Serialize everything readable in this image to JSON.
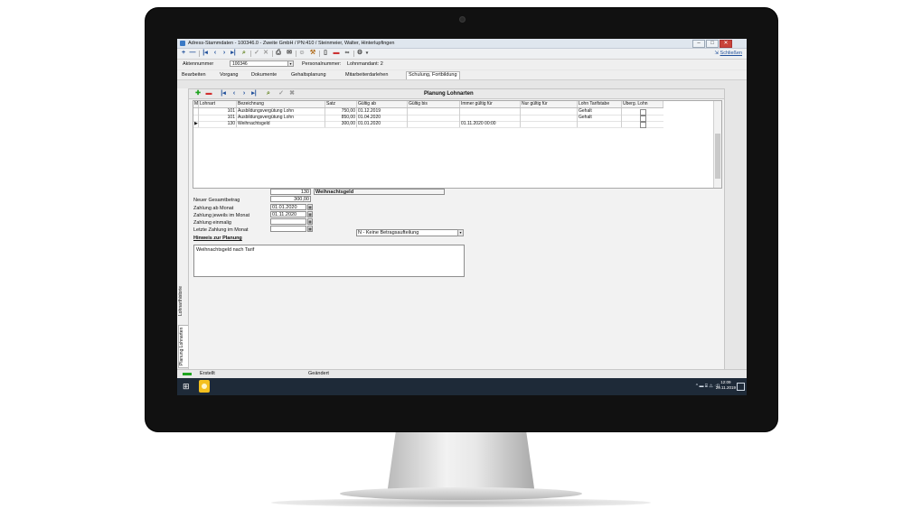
{
  "window": {
    "title": "Adress-Stammdaten - 100346.0 - Zweite GmbH / PN:410 / Steinmeier, Walter, Hinterlupfingen"
  },
  "toolbar": {
    "close_label": "Schließen"
  },
  "header_fields": {
    "aktennummer_label": "Aktennummer",
    "aktennummer_value": "100346",
    "personalnummer_label": "Personalnummer:",
    "lohnmandant_label": "Lohnmandant: 2"
  },
  "menu_tabs": [
    "Bearbeiten",
    "Vorgang",
    "Dokumente",
    "Gehaltsplanung",
    "Mitarbeiterdarlehen",
    "Schulung, Fortbildung"
  ],
  "side_tabs": [
    "Lohnarthistorie",
    "Planung Lohnarten"
  ],
  "panel": {
    "title": "Planung Lohnarten"
  },
  "grid": {
    "columns": [
      "M",
      "Lohnart",
      "Bezeichnung",
      "Satz",
      "Gültig ab",
      "Gültig bis",
      "Immer gültig für",
      "Nur gültig für",
      "Lohn Tarifstabe",
      "Überg. Lohn"
    ],
    "rows": [
      {
        "marker": "",
        "lohnart": "101",
        "bezeichnung": "Ausbildungsvergütung Lohn",
        "satz": "750,00",
        "gueltig_ab": "01.12.2019",
        "gueltig_bis": "",
        "immer": "",
        "nur": "",
        "tarif": "Gehalt"
      },
      {
        "marker": "",
        "lohnart": "101",
        "bezeichnung": "Ausbildungsvergütung Lohn",
        "satz": "850,00",
        "gueltig_ab": "01.04.2020",
        "gueltig_bis": "",
        "immer": "",
        "nur": "",
        "tarif": "Gehalt"
      },
      {
        "marker": "▶",
        "lohnart": "130",
        "bezeichnung": "Weihnachtsgeld",
        "satz": "300,00",
        "gueltig_ab": "01.01.2020",
        "gueltig_bis": "",
        "immer": "01.11.2020 00:00",
        "nur": "",
        "tarif": ""
      }
    ]
  },
  "detail": {
    "lohnart_nr": "130",
    "lohnart_name": "Weihnachtsgeld",
    "neuer_gesamtbetrag_label": "Neuer Gesamtbetrag",
    "neuer_gesamtbetrag_value": "300,00",
    "zahlung_ab_label": "Zahlung ab Monat",
    "zahlung_ab_value": "01.01.2020",
    "zahlung_jeweils_label": "Zahlung jeweils im Monat",
    "zahlung_jeweils_value": "01.11.2020",
    "zahlung_einmalig_label": "Zahlung einmalig",
    "letzte_zahlung_label": "Letzte Zahlung im Monat",
    "aufteilung_value": "N - Keine Betragsaufteilung",
    "hinweis_label": "Hinweis zur Planung",
    "hinweis_text": "Weihnachtsgeld nach Tarif"
  },
  "statusbar": {
    "erstellt": "Erstellt",
    "geaendert": "Geändert"
  },
  "taskbar": {
    "time": "12:09",
    "date": "29.11.2019"
  },
  "colors": {
    "accent_blue": "#1f4f9a",
    "add_green": "#1fa41f",
    "delete_red": "#d22f2f",
    "taskbar": "#1e2a38"
  }
}
